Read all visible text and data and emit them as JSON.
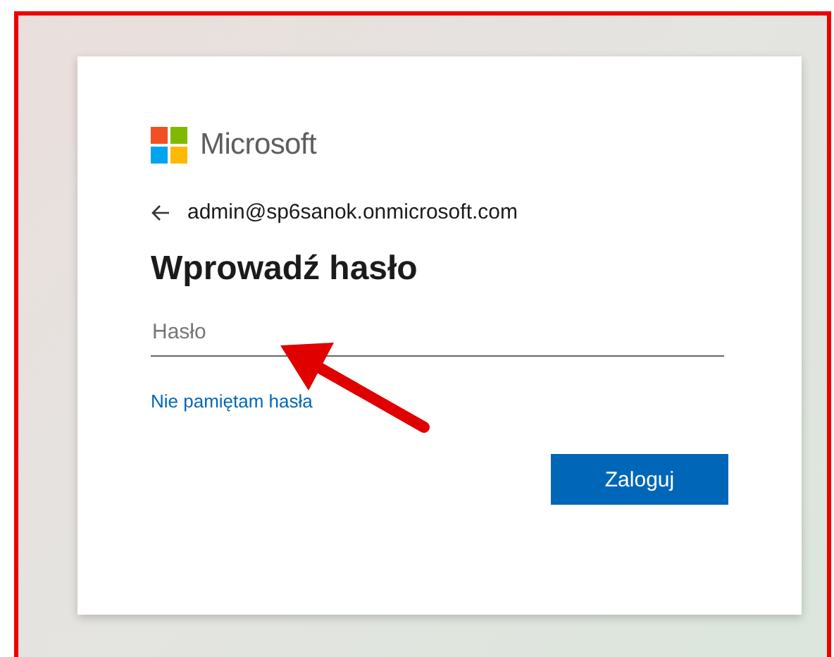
{
  "brand": {
    "name": "Microsoft"
  },
  "account": {
    "email": "admin@sp6sanok.onmicrosoft.com"
  },
  "title": "Wprowadź hasło",
  "password": {
    "placeholder": "Hasło"
  },
  "link": "Nie pamiętam hasła",
  "button": "Zaloguj"
}
